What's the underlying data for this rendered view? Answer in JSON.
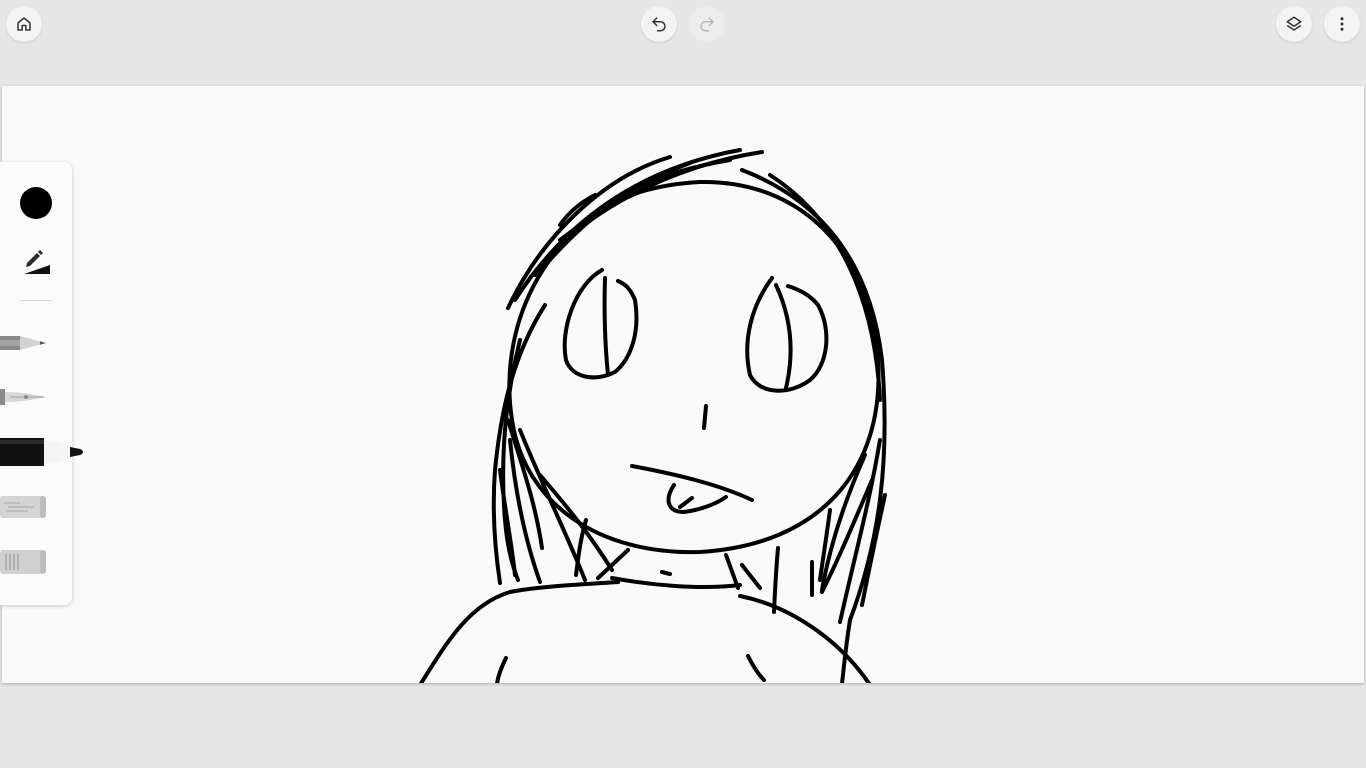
{
  "toolbar": {
    "home_icon": "home-icon",
    "undo_icon": "undo-icon",
    "redo_icon": "redo-icon",
    "redo_enabled": false,
    "layers_icon": "layers-icon",
    "more_icon": "more-vert-icon"
  },
  "tool_panel": {
    "current_color": "#000000",
    "tools": [
      {
        "name": "pencil",
        "icon": "pencil-icon"
      },
      {
        "name": "pen",
        "icon": "fountain-pen-icon"
      },
      {
        "name": "marker",
        "icon": "marker-icon",
        "selected": true
      },
      {
        "name": "highlighter",
        "icon": "highlighter-icon"
      },
      {
        "name": "eraser",
        "icon": "eraser-icon"
      }
    ]
  },
  "canvas": {
    "background": "#f9f9f9",
    "stroke_color": "#000000"
  }
}
